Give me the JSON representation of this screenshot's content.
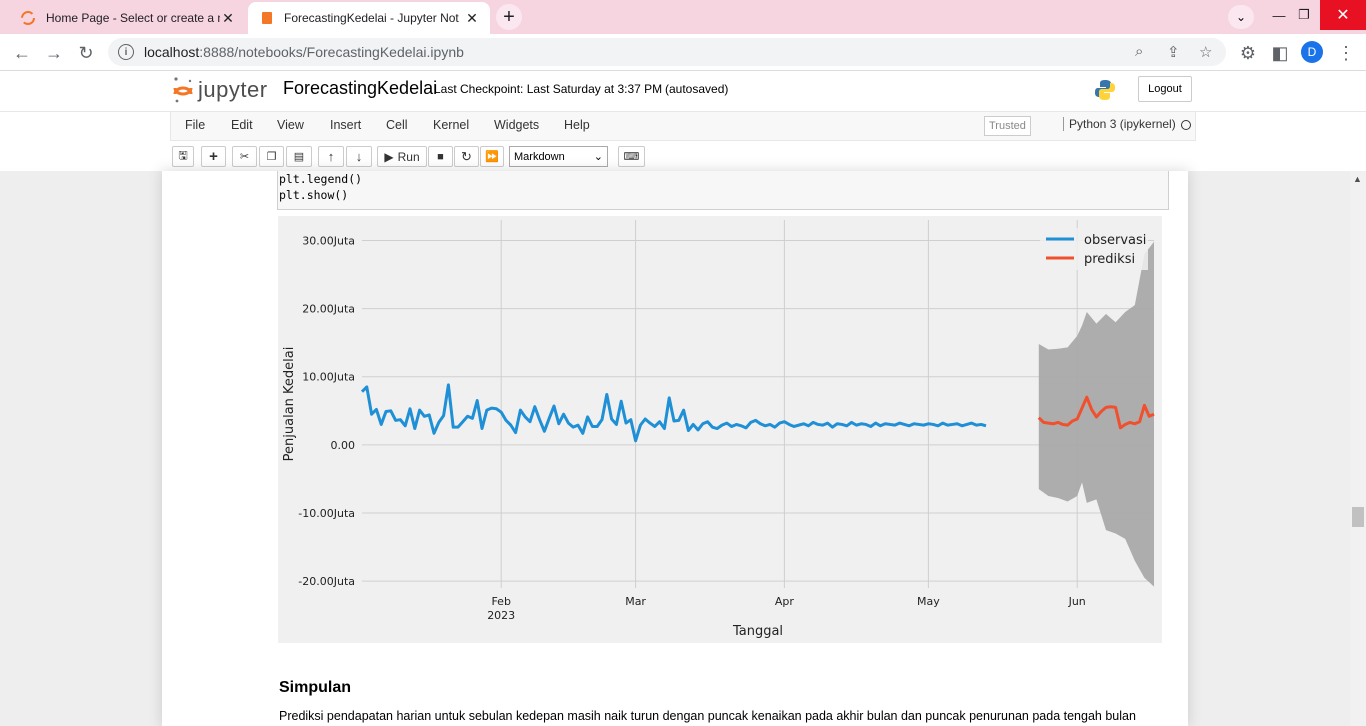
{
  "browser": {
    "tabs": [
      {
        "title": "Home Page - Select or create a n",
        "active": false
      },
      {
        "title": "ForecastingKedelai - Jupyter Not",
        "active": true
      }
    ],
    "url_host": "localhost",
    "url_path": ":8888/notebooks/ForecastingKedelai.ipynb",
    "profile_initial": "D",
    "tab_strip_color": "#f6d4e0"
  },
  "jupyter": {
    "logo_text": "jupyter",
    "notebook_name": "ForecastingKedelai",
    "checkpoint": "Last Checkpoint: Last Saturday at 3:37 PM",
    "autosave": "(autosaved)",
    "logout_label": "Logout",
    "menus": [
      "File",
      "Edit",
      "View",
      "Insert",
      "Cell",
      "Kernel",
      "Widgets",
      "Help"
    ],
    "trusted_label": "Trusted",
    "kernel_label": "Python 3 (ipykernel)",
    "run_label": "Run",
    "cell_type": "Markdown"
  },
  "cell": {
    "code_lines": [
      "plt.legend()",
      "plt.show()"
    ]
  },
  "markdown": {
    "heading": "Simpulan",
    "paragraph": "Prediksi pendapatan harian untuk sebulan kedepan masih naik turun dengan puncak kenaikan pada akhir bulan dan puncak penurunan pada tengah bulan"
  },
  "chart_data": {
    "type": "line",
    "xlabel": "Tanggal",
    "ylabel": "Penjualan Kedelai",
    "y_ticks": [
      "30.00Juta",
      "20.00Juta",
      "10.00Juta",
      "0.00",
      "-10.00Juta",
      "-20.00Juta"
    ],
    "y_tick_values": [
      30,
      20,
      10,
      0,
      -10,
      -20
    ],
    "ylim": [
      -21,
      33
    ],
    "x_ticks": [
      {
        "label": "Feb",
        "sub": "2023",
        "x": 32
      },
      {
        "label": "Mar",
        "x": 60
      },
      {
        "label": "Apr",
        "x": 91
      },
      {
        "label": "May",
        "x": 121
      },
      {
        "label": "Jun",
        "x": 152
      }
    ],
    "xlim": [
      3,
      168
    ],
    "y_unit": "Juta",
    "grid": true,
    "legend_position": "top-right",
    "colors": {
      "observasi": "#1f8fd6",
      "prediksi": "#f0502d",
      "interval": "#a9a9a9"
    },
    "series": [
      {
        "name": "observasi",
        "x": [
          3,
          4,
          5,
          6,
          7,
          8,
          9,
          10,
          11,
          12,
          13,
          14,
          15,
          16,
          17,
          18,
          19,
          20,
          21,
          22,
          23,
          24,
          25,
          26,
          27,
          28,
          29,
          30,
          31,
          32,
          33,
          34,
          35,
          36,
          37,
          38,
          39,
          40,
          41,
          42,
          43,
          44,
          45,
          46,
          47,
          48,
          49,
          50,
          51,
          52,
          53,
          54,
          55,
          56,
          57,
          58,
          59,
          60,
          61,
          62,
          63,
          64,
          65,
          66,
          67,
          68,
          69,
          70,
          71,
          72,
          73,
          74,
          75,
          76,
          77,
          78,
          79,
          80,
          81,
          82,
          83,
          84,
          85,
          86,
          87,
          88,
          89,
          90,
          91,
          92,
          93,
          94,
          95,
          96,
          97,
          98,
          99,
          100,
          101,
          102,
          103,
          104,
          105,
          106,
          107,
          108,
          109,
          110,
          111,
          112,
          113,
          114,
          115,
          116,
          117,
          118,
          119,
          120,
          121,
          122,
          123,
          124,
          125,
          126,
          127,
          128,
          129,
          130,
          131,
          132,
          133
        ],
        "values": [
          7.8,
          8.5,
          4.5,
          5.2,
          3.0,
          4.9,
          5.0,
          3.6,
          3.7,
          2.8,
          5.3,
          2.4,
          5.1,
          4.2,
          4.4,
          1.7,
          3.3,
          4.3,
          8.8,
          2.6,
          2.6,
          3.4,
          4.2,
          3.9,
          6.5,
          2.4,
          5.1,
          5.4,
          5.3,
          4.8,
          3.6,
          2.9,
          1.8,
          5.1,
          4.1,
          3.4,
          5.6,
          3.7,
          2.0,
          3.9,
          5.7,
          3.1,
          4.5,
          3.2,
          2.6,
          2.9,
          1.7,
          4.1,
          2.7,
          2.7,
          3.7,
          7.4,
          3.8,
          3.0,
          6.4,
          3.2,
          3.7,
          0.6,
          2.9,
          3.8,
          3.2,
          2.7,
          3.4,
          2.4,
          6.9,
          3.5,
          3.6,
          5.1,
          2.1,
          3.0,
          2.2,
          3.1,
          3.4,
          2.6,
          2.4,
          2.9,
          3.2,
          2.7,
          3.0,
          2.8,
          2.5,
          3.3,
          3.6,
          3.1,
          2.8,
          3.0,
          2.6,
          3.2,
          3.4,
          3.0,
          2.7,
          2.9,
          3.1,
          2.8,
          3.3,
          3.0,
          2.9,
          3.2,
          2.6,
          3.1,
          3.0,
          2.8,
          3.3,
          2.9,
          3.1,
          3.0,
          2.7,
          3.2,
          2.8,
          3.1,
          3.0,
          2.9,
          3.2,
          3.0,
          2.8,
          3.1,
          3.0,
          2.9,
          3.1,
          3.0,
          2.8,
          3.2,
          2.9,
          3.0,
          3.1,
          2.8,
          3.0,
          3.2,
          2.9,
          3.0,
          2.8
        ]
      },
      {
        "name": "prediksi",
        "x": [
          144,
          145,
          146,
          147,
          148,
          149,
          150,
          151,
          152,
          153,
          154,
          155,
          156,
          157,
          158,
          159,
          160,
          161,
          162,
          163,
          164,
          165,
          166,
          167,
          168
        ],
        "values": [
          4.0,
          3.3,
          3.2,
          3.1,
          3.3,
          3.0,
          2.9,
          3.5,
          3.8,
          5.4,
          7.0,
          5.2,
          4.1,
          4.9,
          5.5,
          5.6,
          5.5,
          2.5,
          3.0,
          3.3,
          3.1,
          3.4,
          5.8,
          4.2,
          4.5
        ]
      }
    ],
    "interval": {
      "x": [
        144,
        146,
        148,
        150,
        152,
        153,
        154,
        156,
        158,
        160,
        162,
        164,
        166,
        168
      ],
      "upper": [
        14.8,
        14.0,
        14.1,
        14.3,
        16.0,
        17.5,
        19.5,
        17.8,
        19.2,
        18.0,
        19.5,
        20.5,
        28.0,
        29.8
      ],
      "lower": [
        -6.5,
        -7.5,
        -7.8,
        -8.3,
        -7.5,
        -5.5,
        -8.5,
        -8.0,
        -12.5,
        -13.0,
        -13.8,
        -17.0,
        -19.5,
        -20.8
      ]
    }
  }
}
